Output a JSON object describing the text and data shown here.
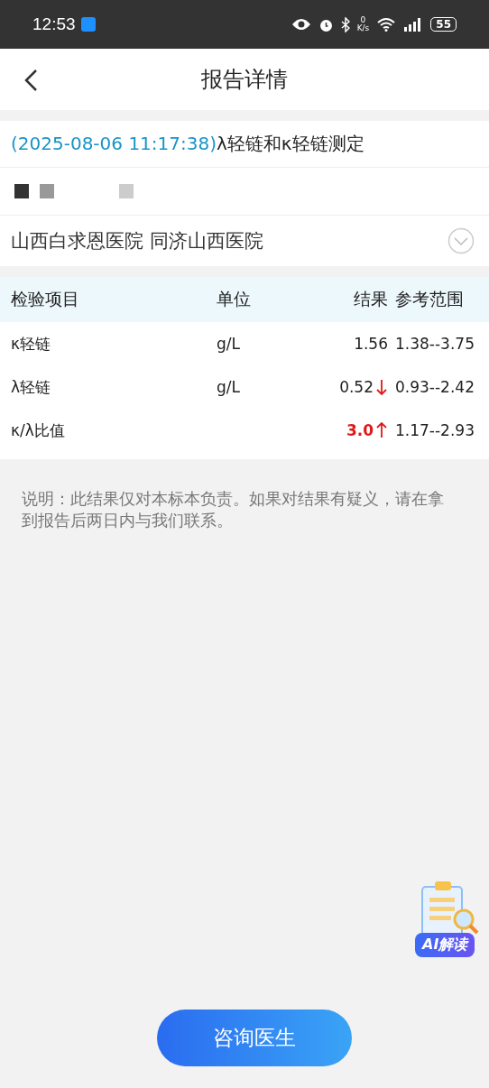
{
  "status_bar": {
    "time": "12:53",
    "net_speed_value": "0",
    "net_speed_unit": "K/s",
    "battery": "55"
  },
  "header": {
    "title": "报告详情"
  },
  "report": {
    "date": "(2025-08-06 11:17:38)",
    "name": "λ轻链和κ轻链测定",
    "hospital": "山西白求恩医院 同济山西医院",
    "expanded": false
  },
  "table": {
    "columns": [
      "检验项目",
      "单位",
      "结果",
      "参考范围"
    ],
    "rows": [
      {
        "item": "κ轻链",
        "unit": "g/L",
        "result": "1.56",
        "kind": "normal",
        "range": "1.38--3.75"
      },
      {
        "item": "λ轻链",
        "unit": "g/L",
        "result": "0.52",
        "kind": "low",
        "range": "0.93--2.42"
      },
      {
        "item": "κ/λ比值",
        "result": "3.0",
        "kind": "high",
        "range": "1.17--2.93"
      }
    ]
  },
  "note": "说明：此结果仅对本标本负责。如果对结果有疑义，请在拿到报告后两日内与我们联系。",
  "ai_badge": {
    "label": "AI解读"
  },
  "consult_button": {
    "label": "咨询医生"
  }
}
